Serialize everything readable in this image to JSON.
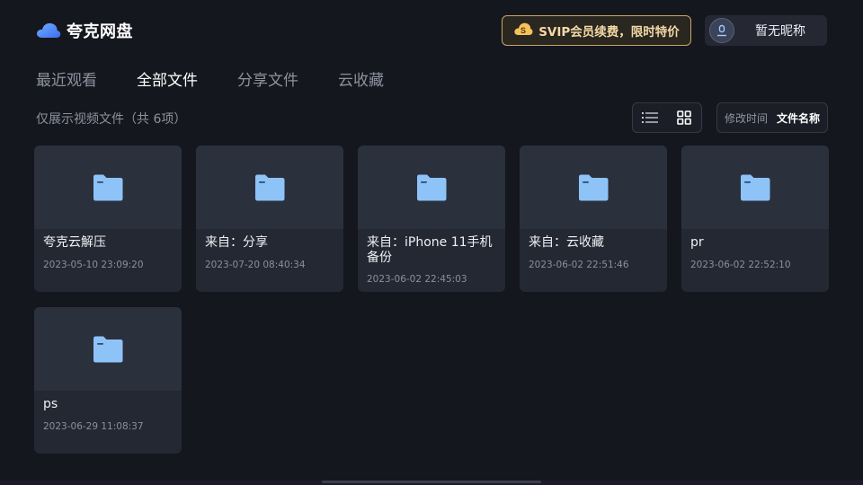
{
  "header": {
    "logo_text": "夸克网盘",
    "vip_label": "SVIP会员续费，限时特价",
    "user_name": "暂无昵称"
  },
  "tabs": [
    {
      "label": "最近观看",
      "active": false
    },
    {
      "label": "全部文件",
      "active": true
    },
    {
      "label": "分享文件",
      "active": false
    },
    {
      "label": "云收藏",
      "active": false
    }
  ],
  "info_text": "仅展示视频文件（共 6项）",
  "view_modes": [
    {
      "icon": "list-view-icon",
      "active": false
    },
    {
      "icon": "grid-view-icon",
      "active": true
    }
  ],
  "sort": {
    "options": [
      {
        "label": "修改时间",
        "active": false
      },
      {
        "label": "文件名称",
        "active": true
      }
    ]
  },
  "files": [
    {
      "name": "夸克云解压",
      "time": "2023-05-10 23:09:20",
      "icon": "folder-icon"
    },
    {
      "name": "来自：分享",
      "time": "2023-07-20 08:40:34",
      "icon": "folder-icon"
    },
    {
      "name": "来自：iPhone 11手机备份",
      "time": "2023-06-02 22:45:03",
      "icon": "folder-icon"
    },
    {
      "name": "来自：云收藏",
      "time": "2023-06-02 22:51:46",
      "icon": "folder-icon"
    },
    {
      "name": "pr",
      "time": "2023-06-02 22:52:10",
      "icon": "folder-icon"
    },
    {
      "name": "ps",
      "time": "2023-06-29 11:08:37",
      "icon": "folder-icon"
    }
  ],
  "colors": {
    "background": "#15171e",
    "card": "#242833",
    "accent_gold": "#f3d9a6",
    "folder_blue": "#8ec3f7"
  }
}
